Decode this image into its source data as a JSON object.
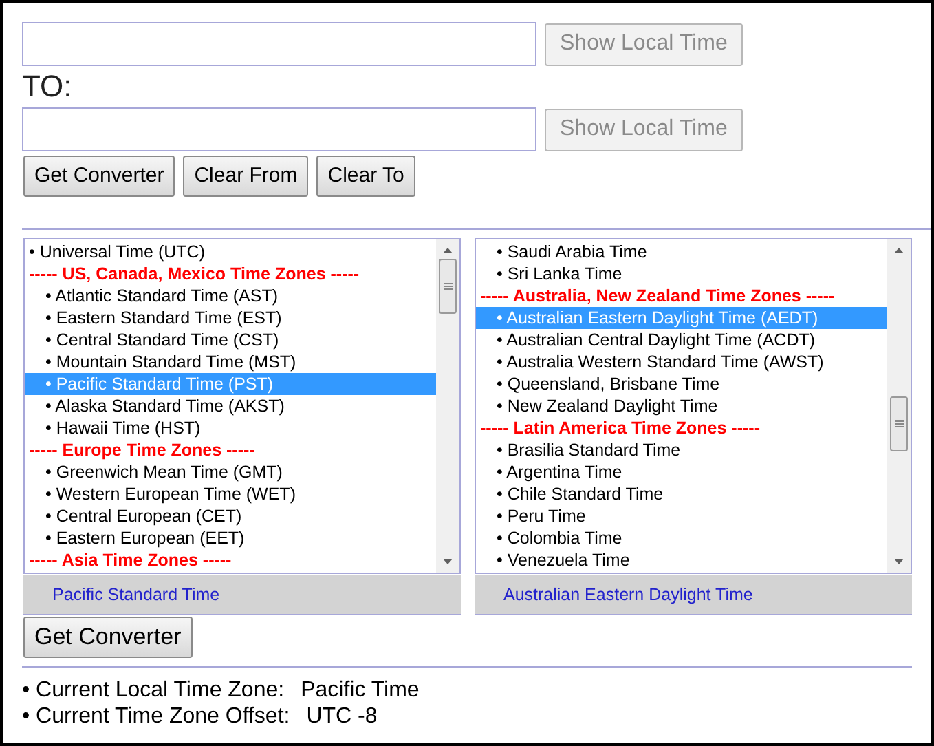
{
  "from": {
    "show_button": "Show Local Time"
  },
  "to_label": "TO:",
  "to": {
    "show_button": "Show Local Time"
  },
  "actions": [
    "Get Converter",
    "Clear From",
    "Clear To"
  ],
  "lists": [
    {
      "items": [
        {
          "kind": "plain",
          "text": "• Universal Time (UTC)",
          "selected": false
        },
        {
          "kind": "header",
          "text": "----- US, Canada, Mexico Time Zones -----",
          "selected": false
        },
        {
          "kind": "zone",
          "text": "• Atlantic Standard Time (AST)",
          "selected": false
        },
        {
          "kind": "zone",
          "text": "• Eastern Standard Time (EST)",
          "selected": false
        },
        {
          "kind": "zone",
          "text": "• Central Standard Time (CST)",
          "selected": false
        },
        {
          "kind": "zone",
          "text": "• Mountain Standard Time (MST)",
          "selected": false
        },
        {
          "kind": "zone",
          "text": "• Pacific Standard Time (PST)",
          "selected": true
        },
        {
          "kind": "zone",
          "text": "• Alaska Standard Time (AKST)",
          "selected": false
        },
        {
          "kind": "zone",
          "text": "• Hawaii Time (HST)",
          "selected": false
        },
        {
          "kind": "header",
          "text": "----- Europe Time Zones -----",
          "selected": false
        },
        {
          "kind": "zone",
          "text": "• Greenwich Mean Time (GMT)",
          "selected": false
        },
        {
          "kind": "zone",
          "text": "• Western European Time (WET)",
          "selected": false
        },
        {
          "kind": "zone",
          "text": "• Central European (CET)",
          "selected": false
        },
        {
          "kind": "zone",
          "text": "• Eastern European (EET)",
          "selected": false
        },
        {
          "kind": "header",
          "text": "----- Asia Time Zones -----",
          "selected": false
        }
      ],
      "caption": "Pacific Standard Time"
    },
    {
      "items": [
        {
          "kind": "zone",
          "text": "• Saudi Arabia Time",
          "selected": false
        },
        {
          "kind": "zone",
          "text": "• Sri Lanka Time",
          "selected": false
        },
        {
          "kind": "header",
          "text": "----- Australia, New Zealand Time Zones -----",
          "selected": false
        },
        {
          "kind": "zone",
          "text": "• Australian Eastern Daylight Time (AEDT)",
          "selected": true
        },
        {
          "kind": "zone",
          "text": "• Australian Central Daylight Time (ACDT)",
          "selected": false
        },
        {
          "kind": "zone",
          "text": "• Australia Western Standard Time (AWST)",
          "selected": false
        },
        {
          "kind": "zone",
          "text": "• Queensland, Brisbane Time",
          "selected": false
        },
        {
          "kind": "zone",
          "text": "• New Zealand Daylight Time",
          "selected": false
        },
        {
          "kind": "header",
          "text": "----- Latin America Time Zones -----",
          "selected": false
        },
        {
          "kind": "zone",
          "text": "• Brasilia Standard Time",
          "selected": false
        },
        {
          "kind": "zone",
          "text": "• Argentina Time",
          "selected": false
        },
        {
          "kind": "zone",
          "text": "• Chile Standard Time",
          "selected": false
        },
        {
          "kind": "zone",
          "text": "• Peru Time",
          "selected": false
        },
        {
          "kind": "zone",
          "text": "• Colombia Time",
          "selected": false
        },
        {
          "kind": "zone",
          "text": "• Venezuela Time",
          "selected": false
        }
      ],
      "caption": "Australian Eastern Daylight Time"
    }
  ],
  "get_converter": "Get Converter",
  "info": [
    {
      "label": "• Current Local Time Zone:",
      "value": "Pacific Time"
    },
    {
      "label": "• Current Time Zone Offset:",
      "value": "UTC -8"
    }
  ]
}
